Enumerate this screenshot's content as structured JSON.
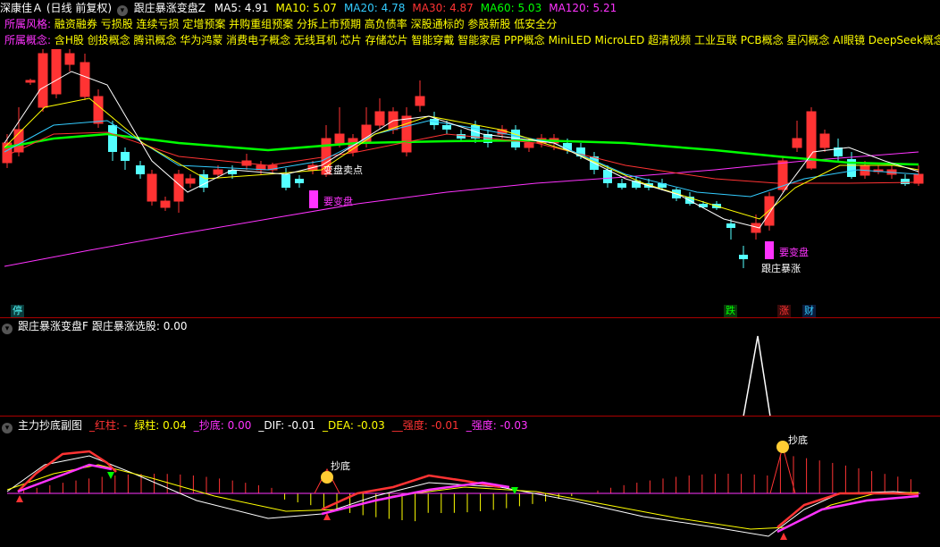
{
  "header": {
    "stock_name": "深康佳Ａ",
    "period": "(日线 前复权)",
    "indicator": "跟庄暴涨变盘Z",
    "ma": [
      {
        "label": "MA5: 4.91",
        "color": "#ffffff"
      },
      {
        "label": "MA10: 5.07",
        "color": "#ffff00"
      },
      {
        "label": "MA20: 4.78",
        "color": "#33ccff"
      },
      {
        "label": "MA30: 4.87",
        "color": "#ff3333"
      },
      {
        "label": "MA60: 5.03",
        "color": "#00ff00"
      },
      {
        "label": "MA120: 5.21",
        "color": "#ff33ff"
      }
    ]
  },
  "style_row": {
    "label": "所属风格:",
    "text": "融资融券 亏损股 连续亏损 定增预案 并购重组预案 分拆上市预期 高负债率 深股通标的 参股新股 低安全分"
  },
  "concept_row": {
    "label": "所属概念:",
    "text": "含H股 创投概念 腾讯概念 华为鸿蒙 消费电子概念 无线耳机 芯片 存储芯片 智能穿戴 智能家居 PPP概念 MiniLED MicroLED 超清视频 工业互联 PCB概念 星闪概念 AI眼镜 DeepSeek概念"
  },
  "annotations": {
    "sell_point": "变盘卖点",
    "change1": "要变盘",
    "change2": "要变盘",
    "surge": "跟庄暴涨",
    "bottom1": "抄底",
    "bottom2": "抄底"
  },
  "bottom_tags": {
    "stop": "停",
    "fall": "跌",
    "rise": "涨",
    "fin": "财"
  },
  "panel2": {
    "title": "跟庄暴涨变盘F",
    "value": "跟庄暴涨选股: 0.00"
  },
  "panel3": {
    "title": "主力抄底副图",
    "items": [
      {
        "label": "_红柱: -",
        "color": "#ff3333"
      },
      {
        "label": "绿柱: 0.04",
        "color": "#ffff00"
      },
      {
        "label": "_抄底: 0.00",
        "color": "#ff33ff"
      },
      {
        "label": "_DIF: -0.01",
        "color": "#ffffff"
      },
      {
        "label": "_DEA: -0.03",
        "color": "#ffff00"
      },
      {
        "label": "__强度: -0.01",
        "color": "#ff3333"
      },
      {
        "label": "_强度: -0.03",
        "color": "#ff33ff"
      }
    ]
  },
  "colors": {
    "up": "#ff3333",
    "down": "#54ffff",
    "ma5": "#ffffff",
    "ma10": "#ffff00",
    "ma20": "#33ccff",
    "ma30": "#ff3333",
    "ma60": "#00ff00",
    "ma120": "#ff33ff",
    "separator": "#aa0000"
  }
}
